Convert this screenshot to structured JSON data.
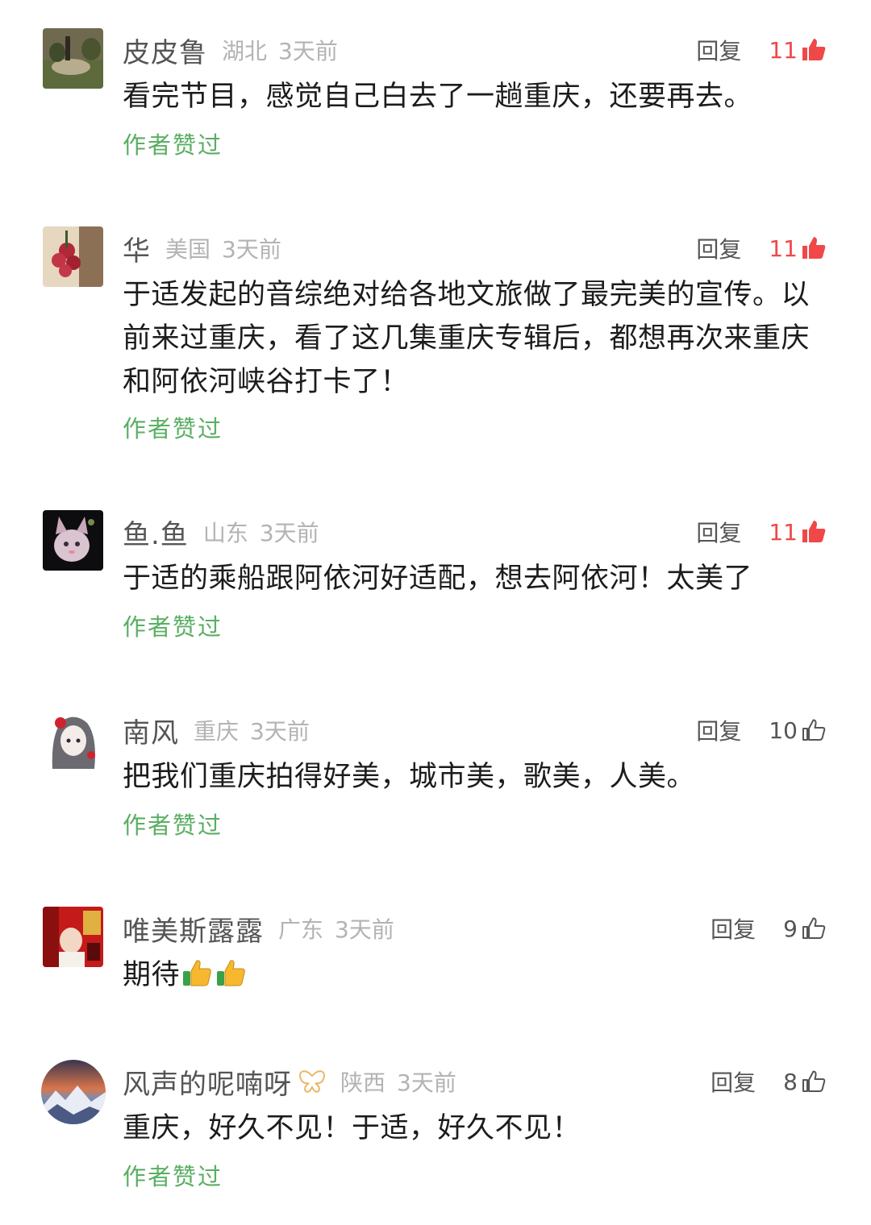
{
  "comments": [
    {
      "name": "皮皮鲁",
      "region": "湖北",
      "time": "3天前",
      "reply": "回复",
      "likes": "11",
      "liked": true,
      "text": "看完节目，感觉自己白去了一趟重庆，还要再去。",
      "author_liked": "作者赞过"
    },
    {
      "name": "华",
      "region": "美国",
      "time": "3天前",
      "reply": "回复",
      "likes": "11",
      "liked": true,
      "text": "于适发起的音综绝对给各地文旅做了最完美的宣传。以前来过重庆，看了这几集重庆专辑后，都想再次来重庆和阿依河峡谷打卡了！",
      "author_liked": "作者赞过"
    },
    {
      "name": "鱼.鱼",
      "region": "山东",
      "time": "3天前",
      "reply": "回复",
      "likes": "11",
      "liked": true,
      "text": "于适的乘船跟阿依河好适配，想去阿依河！太美了",
      "author_liked": "作者赞过"
    },
    {
      "name": "南风",
      "region": "重庆",
      "time": "3天前",
      "reply": "回复",
      "likes": "10",
      "liked": false,
      "text": "把我们重庆拍得好美，城市美，歌美，人美。",
      "author_liked": "作者赞过"
    },
    {
      "name": "唯美斯露露",
      "region": "广东",
      "time": "3天前",
      "reply": "回复",
      "likes": "9",
      "liked": false,
      "text": "期待",
      "emojis": [
        "thumbs-up-emoji",
        "thumbs-up-emoji"
      ]
    },
    {
      "name": "风声的呢喃呀",
      "region": "陕西",
      "time": "3天前",
      "reply": "回复",
      "likes": "8",
      "liked": false,
      "text": "重庆，好久不见！于适，好久不见！",
      "author_liked": "作者赞过",
      "badge_icon": "butterfly-icon"
    }
  ],
  "colors": {
    "liked": "#f04848",
    "author_liked": "#5aae63",
    "meta": "#b3b3b3"
  }
}
